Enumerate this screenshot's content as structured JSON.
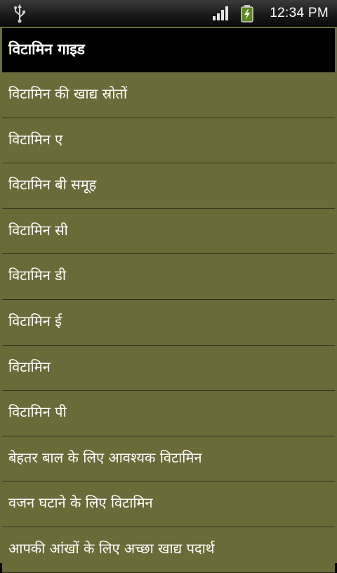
{
  "status_bar": {
    "usb_icon": "usb-icon",
    "signal_icon": "signal-icon",
    "battery_icon": "battery-charging-icon",
    "time": "12:34 PM"
  },
  "app": {
    "title": "विटामिन गाइड",
    "items": [
      {
        "label": "विटामिन की खाद्य स्रोतों"
      },
      {
        "label": "विटामिन ए"
      },
      {
        "label": "विटामिन बी समूह"
      },
      {
        "label": "विटामिन सी"
      },
      {
        "label": "विटामिन डी"
      },
      {
        "label": "विटामिन ई"
      },
      {
        "label": "विटामिन"
      },
      {
        "label": "विटामिन पी"
      },
      {
        "label": "बेहतर बाल के लिए आवश्यक विटामिन"
      },
      {
        "label": "वजन घटाने के लिए विटामिन"
      },
      {
        "label": "आपकी आंखों के लिए अच्छा खाद्य पदार्थ"
      }
    ]
  },
  "colors": {
    "list_background": "#6b6b3a",
    "title_background": "#000000",
    "text": "#ffffff"
  }
}
